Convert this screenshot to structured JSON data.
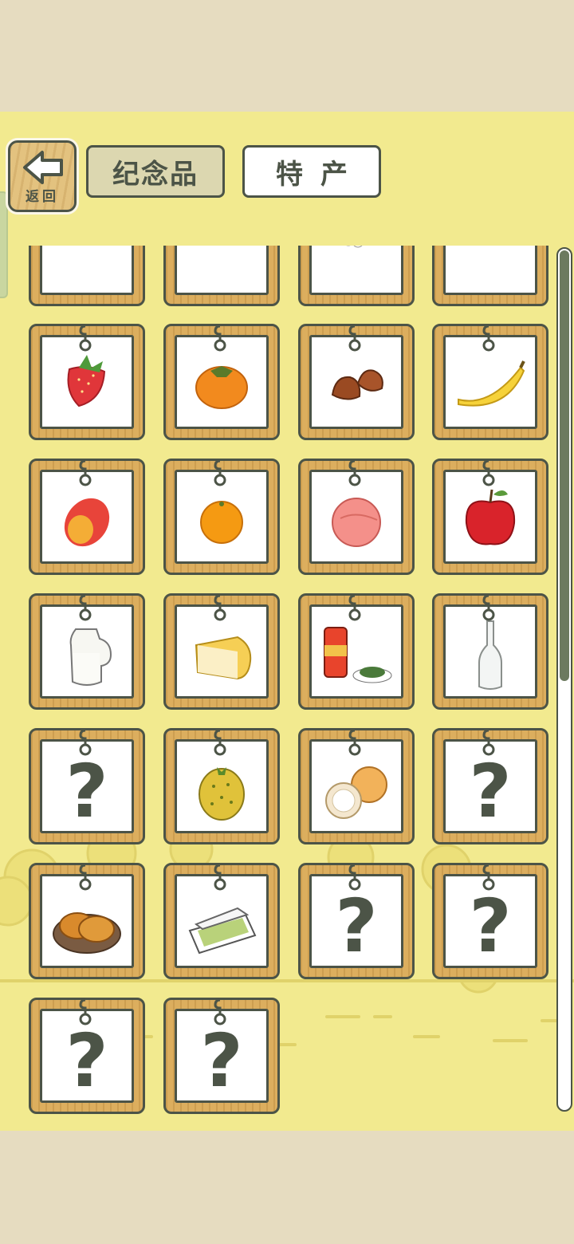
{
  "header": {
    "back_label": "返回",
    "tabs": [
      {
        "label": "纪念品",
        "selected": false
      },
      {
        "label": "特产",
        "selected": true
      }
    ]
  },
  "items": [
    {
      "icon": "onion-icon",
      "unlocked": true
    },
    {
      "icon": "garlic-icon",
      "unlocked": true
    },
    {
      "icon": "green-onion-icon",
      "unlocked": true
    },
    {
      "icon": "chili-pepper-icon",
      "unlocked": true
    },
    {
      "icon": "strawberry-icon",
      "unlocked": true
    },
    {
      "icon": "persimmon-icon",
      "unlocked": true
    },
    {
      "icon": "chestnut-icon",
      "unlocked": true
    },
    {
      "icon": "banana-icon",
      "unlocked": true
    },
    {
      "icon": "mango-icon",
      "unlocked": true
    },
    {
      "icon": "mandarin-orange-icon",
      "unlocked": true
    },
    {
      "icon": "peach-icon",
      "unlocked": true
    },
    {
      "icon": "apple-icon",
      "unlocked": true
    },
    {
      "icon": "milk-jug-icon",
      "unlocked": true
    },
    {
      "icon": "cheese-icon",
      "unlocked": true
    },
    {
      "icon": "tea-can-icon",
      "unlocked": true
    },
    {
      "icon": "glass-bottle-icon",
      "unlocked": true
    },
    {
      "icon": "question-mark-icon",
      "unlocked": false
    },
    {
      "icon": "kiwano-icon",
      "unlocked": true
    },
    {
      "icon": "coconut-icon",
      "unlocked": true
    },
    {
      "icon": "question-mark-icon",
      "unlocked": false
    },
    {
      "icon": "bun-plate-icon",
      "unlocked": true
    },
    {
      "icon": "bento-box-icon",
      "unlocked": true
    },
    {
      "icon": "question-mark-icon",
      "unlocked": false
    },
    {
      "icon": "question-mark-icon",
      "unlocked": false
    },
    {
      "icon": "question-mark-icon",
      "unlocked": false
    },
    {
      "icon": "question-mark-icon",
      "unlocked": false
    }
  ],
  "colors": {
    "background": "#f2ea8f",
    "frame_wood": "#dcae5e",
    "outline": "#4c5447",
    "scroll_thumb": "#6c7a5f"
  }
}
